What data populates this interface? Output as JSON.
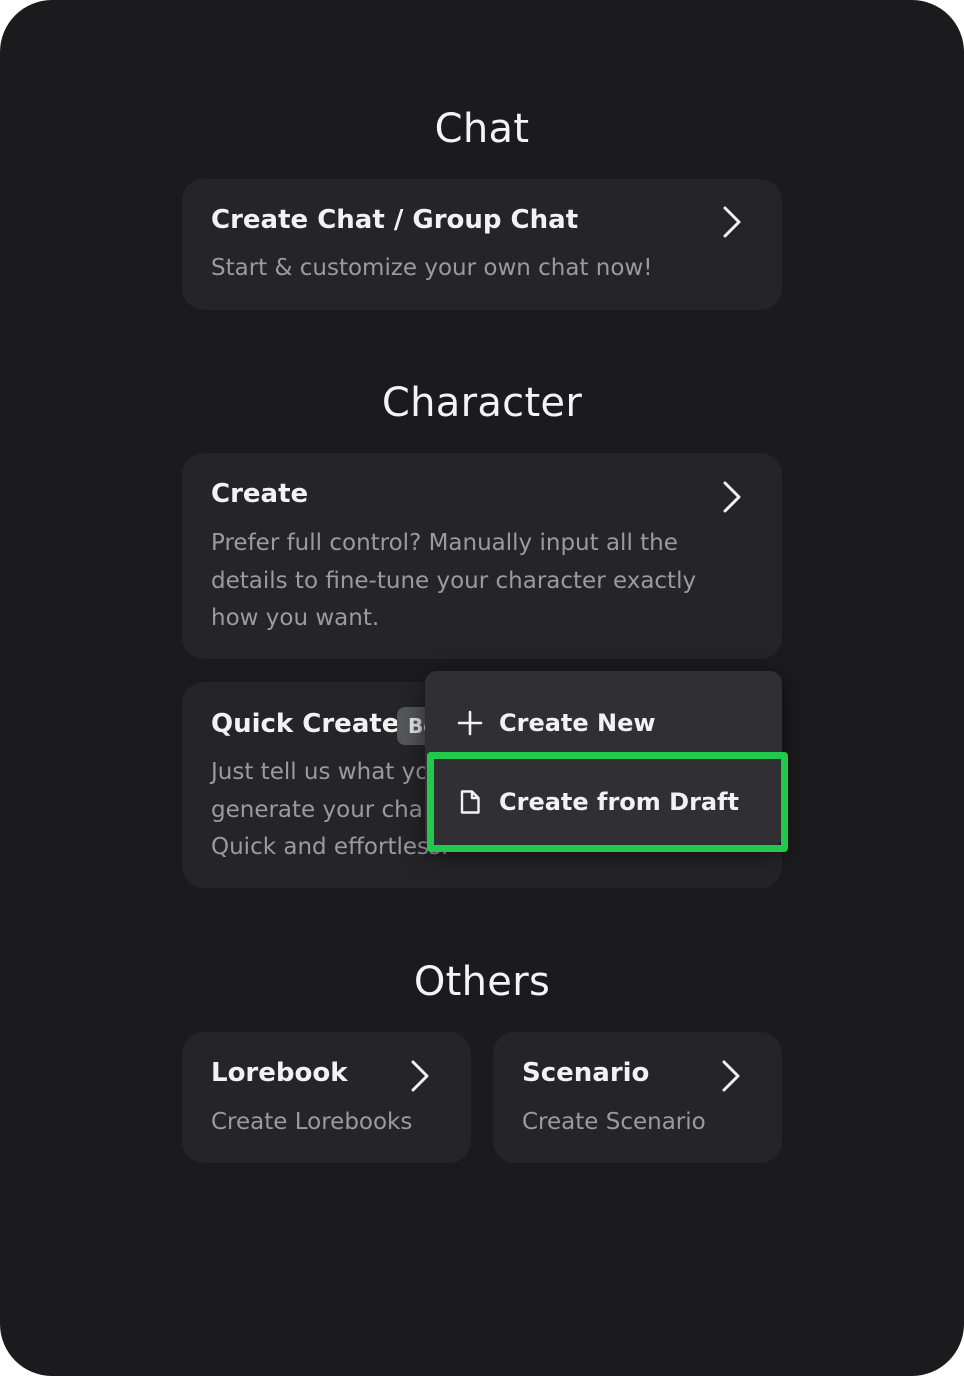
{
  "sections": {
    "chat": {
      "title": "Chat",
      "card": {
        "title": "Create Chat / Group Chat",
        "desc": "Start & customize your own chat now!"
      }
    },
    "character": {
      "title": "Character",
      "create": {
        "title": "Create",
        "desc_lines": [
          "Prefer full control? Manually input all the",
          "details to fine-tune your character exactly",
          "how you want."
        ]
      },
      "quick_create": {
        "title": "Quick Create",
        "badge": "Beta",
        "desc_lines": [
          "Just tell us what you want, and we'll",
          "generate your character for you.",
          "Quick and effortless."
        ]
      }
    },
    "others": {
      "title": "Others",
      "lorebook": {
        "title": "Lorebook",
        "desc": "Create Lorebooks"
      },
      "scenario": {
        "title": "Scenario",
        "desc": "Create Scenario"
      }
    }
  },
  "dropdown_menu": {
    "items": [
      {
        "label": "Create New",
        "icon": "plus-icon"
      },
      {
        "label": "Create from Draft",
        "icon": "document-icon"
      }
    ]
  },
  "colors": {
    "background": "#1b1b1d",
    "card": "#252528",
    "menu": "#303034",
    "highlight": "#22c94a",
    "text_primary": "#f2f2f3",
    "text_secondary": "#9a9aa0"
  }
}
